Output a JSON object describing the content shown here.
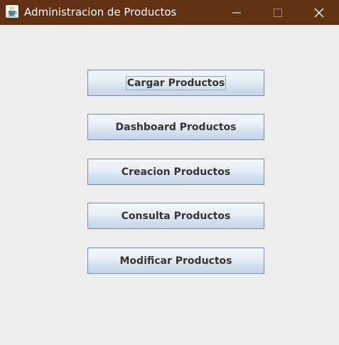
{
  "window": {
    "title": "Administracion de Productos",
    "titlebar_color": "#613113",
    "background_color": "#eeeeee",
    "app_icon": "java-coffee-cup-icon",
    "controls": {
      "minimize_icon": "minimize-icon",
      "maximize_icon": "maximize-icon",
      "close_icon": "close-icon"
    }
  },
  "menu": {
    "buttons": [
      {
        "label": "Cargar Productos",
        "focused": true
      },
      {
        "label": "Dashboard Productos",
        "focused": false
      },
      {
        "label": "Creacion Productos",
        "focused": false
      },
      {
        "label": "Consulta Productos",
        "focused": false
      },
      {
        "label": "Modificar Productos",
        "focused": false
      }
    ]
  }
}
